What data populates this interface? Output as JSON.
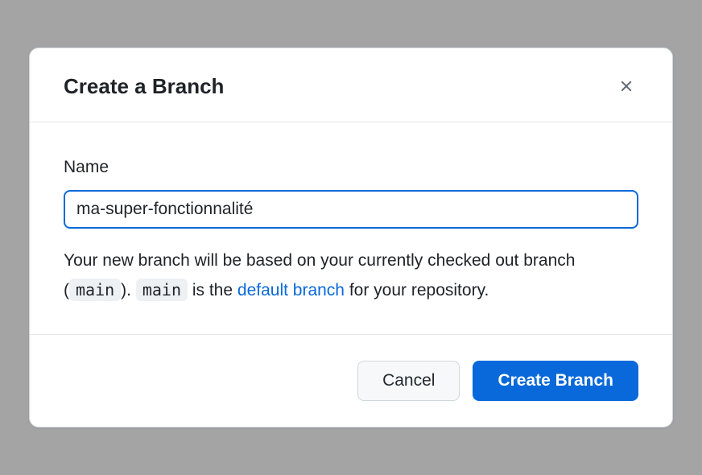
{
  "dialog": {
    "title": "Create a Branch",
    "name_field": {
      "label": "Name",
      "value": "ma-super-fonctionnalité"
    },
    "help": {
      "prefix": "Your new branch will be based on your currently checked out branch (",
      "branch_code_1": "main",
      "mid1": "). ",
      "branch_code_2": "main",
      "mid2": " is the ",
      "link_text": "default branch",
      "suffix": " for your repository."
    },
    "buttons": {
      "cancel": "Cancel",
      "create": "Create Branch"
    }
  }
}
